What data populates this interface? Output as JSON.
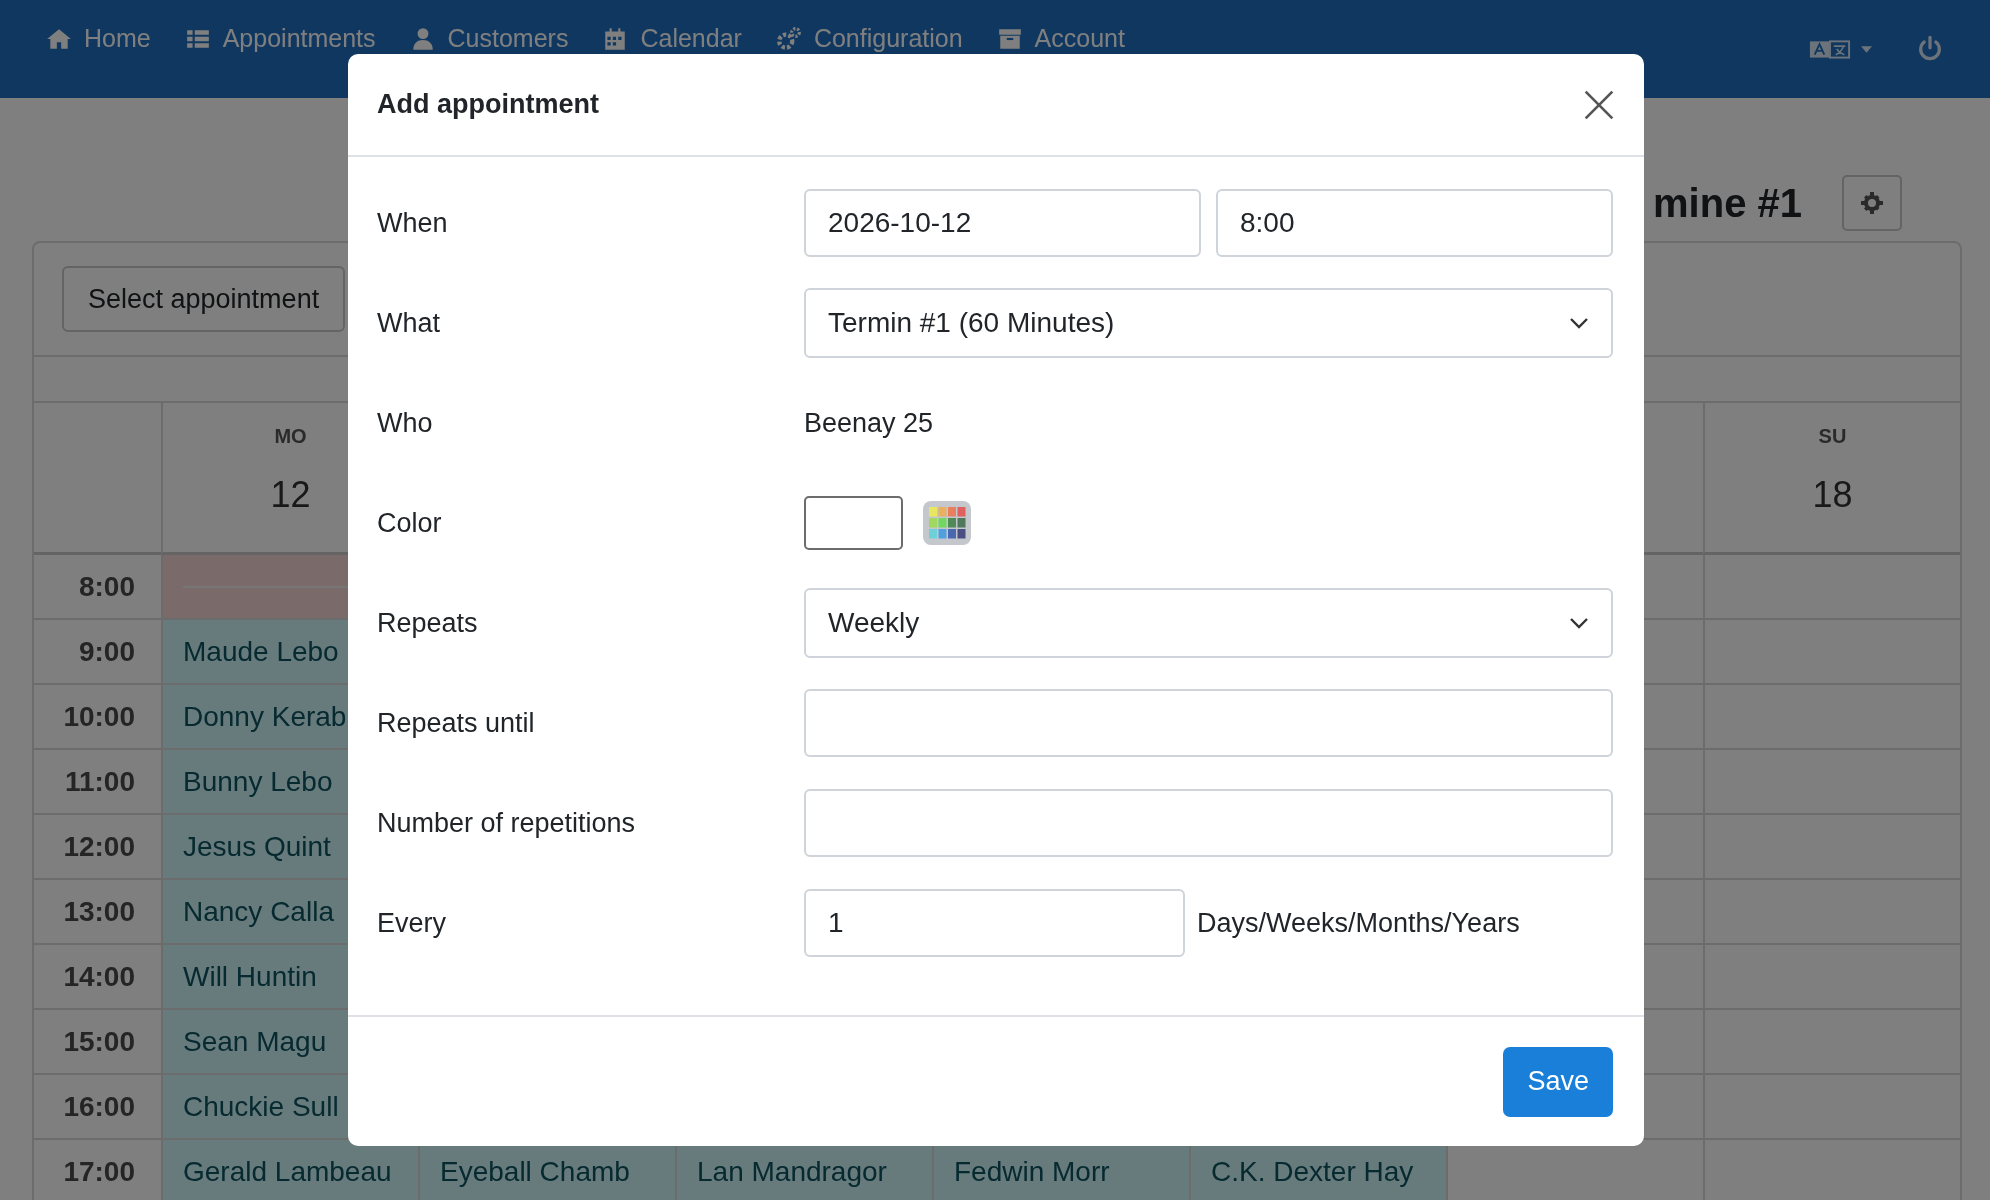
{
  "navbar": {
    "items": [
      {
        "label": "Home"
      },
      {
        "label": "Appointments"
      },
      {
        "label": "Customers"
      },
      {
        "label": "Calendar"
      },
      {
        "label": "Configuration"
      },
      {
        "label": "Account"
      }
    ]
  },
  "calendar": {
    "heading": "mine #1",
    "select_button": "Select appointment",
    "monday": {
      "weekday": "MO",
      "date": "12"
    },
    "sunday": {
      "weekday": "SU",
      "date": "18"
    },
    "rows": [
      {
        "time": "8:00",
        "cells": [
          {
            "kind": "blocked"
          }
        ]
      },
      {
        "time": "9:00",
        "cells": [
          {
            "kind": "appointment",
            "name": "Maude Lebo"
          }
        ]
      },
      {
        "time": "10:00",
        "cells": [
          {
            "kind": "appointment",
            "name": "Donny Kerab"
          }
        ]
      },
      {
        "time": "11:00",
        "cells": [
          {
            "kind": "appointment",
            "name": "Bunny Lebo"
          }
        ]
      },
      {
        "time": "12:00",
        "cells": [
          {
            "kind": "appointment",
            "name": "Jesus Quint"
          }
        ]
      },
      {
        "time": "13:00",
        "cells": [
          {
            "kind": "appointment",
            "name": "Nancy Calla"
          }
        ]
      },
      {
        "time": "14:00",
        "cells": [
          {
            "kind": "appointment",
            "name": "Will Huntin"
          }
        ]
      },
      {
        "time": "15:00",
        "cells": [
          {
            "kind": "appointment",
            "name": "Sean Magu"
          }
        ]
      },
      {
        "time": "16:00",
        "cells": [
          {
            "kind": "appointment",
            "name": "Chuckie Sull"
          }
        ]
      },
      {
        "time": "17:00",
        "cells": [
          {
            "kind": "appointment",
            "name": "Gerald Lambeau"
          },
          {
            "kind": "appointment",
            "name": "Eyeball Chamb"
          },
          {
            "kind": "appointment",
            "name": "Lan Mandragor"
          },
          {
            "kind": "appointment",
            "name": "Fedwin Morr"
          },
          {
            "kind": "appointment",
            "name": "C.K. Dexter Hay"
          }
        ]
      }
    ]
  },
  "modal": {
    "title": "Add appointment",
    "fields": [
      {
        "label": "When",
        "kind": "datetime",
        "date": "2026-10-12",
        "time": "8:00"
      },
      {
        "label": "What",
        "kind": "select",
        "value": "Termin #1 (60 Minutes)"
      },
      {
        "label": "Who",
        "kind": "text",
        "value": "Beenay 25"
      },
      {
        "label": "Color",
        "kind": "color",
        "color": "#ffffff"
      },
      {
        "label": "Repeats",
        "kind": "select",
        "value": "Weekly"
      },
      {
        "label": "Repeats until",
        "kind": "input"
      },
      {
        "label": "Number of repetitions",
        "kind": "input"
      },
      {
        "label": "Every",
        "kind": "interval",
        "value": "1",
        "unit": "Days/Weeks/Months/Years"
      }
    ],
    "save_button": "Save"
  }
}
